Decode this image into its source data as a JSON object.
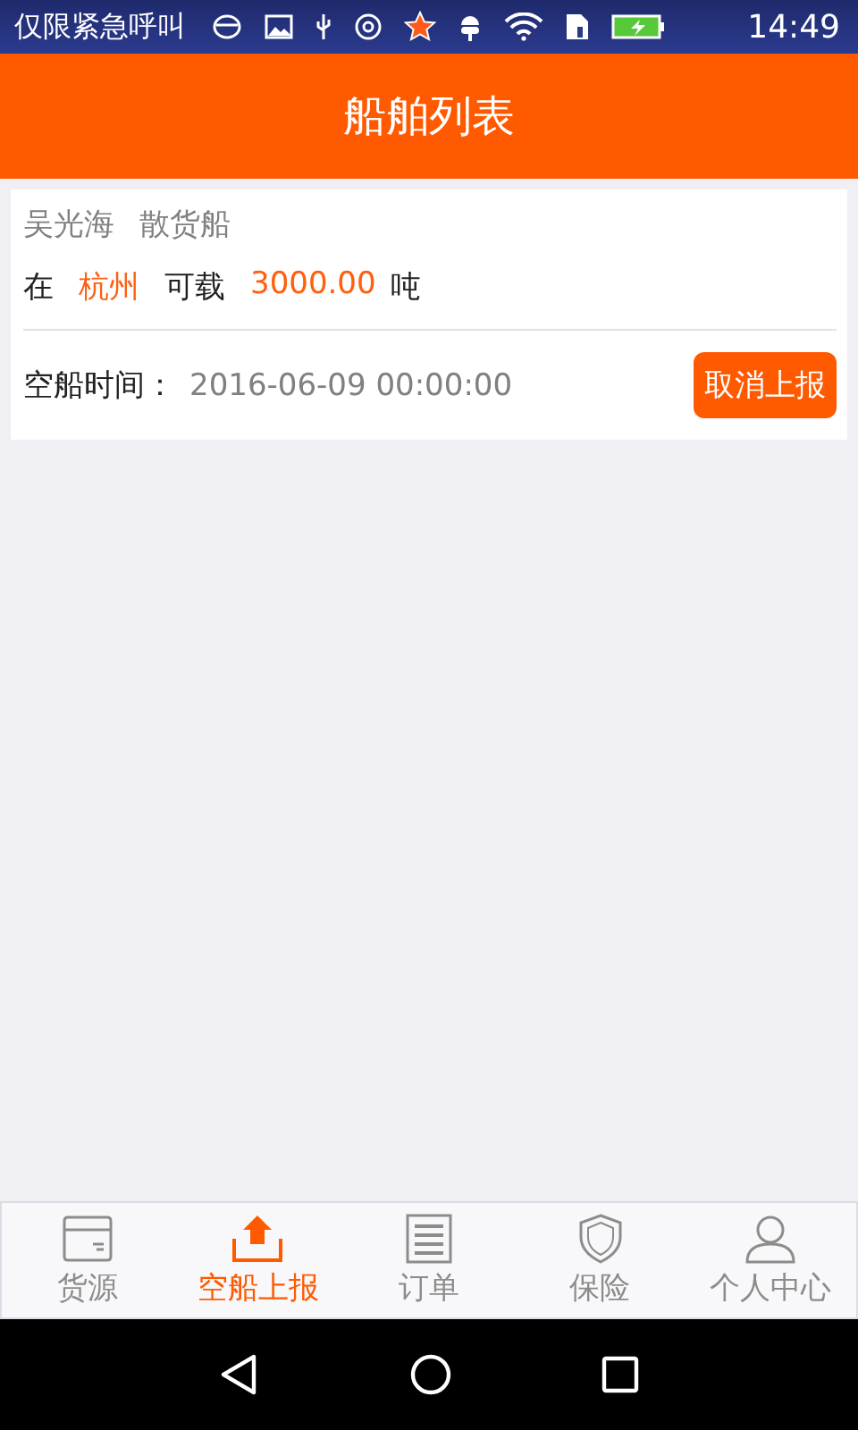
{
  "status_bar": {
    "carrier": "仅限紧急呼叫",
    "time": "14:49"
  },
  "header": {
    "title": "船舶列表"
  },
  "ships": [
    {
      "owner": "吴光海",
      "type": "散货船",
      "at_label": "在",
      "location": "杭州",
      "capacity_label": "可载",
      "capacity": "3000.00",
      "unit": "吨",
      "time_label": "空船时间：",
      "time": "2016-06-09 00:00:00",
      "action": "取消上报"
    }
  ],
  "tabs": [
    {
      "label": "货源",
      "selected": false
    },
    {
      "label": "空船上报",
      "selected": true
    },
    {
      "label": "订单",
      "selected": false
    },
    {
      "label": "保险",
      "selected": false
    },
    {
      "label": "个人中心",
      "selected": false
    }
  ]
}
